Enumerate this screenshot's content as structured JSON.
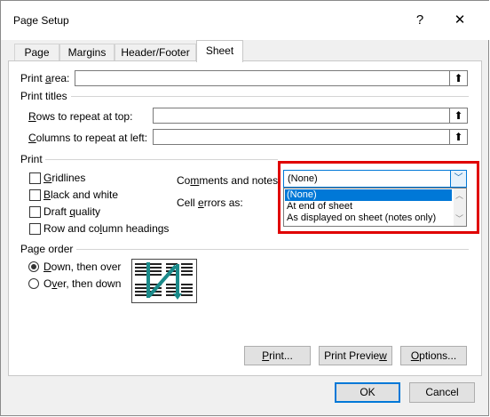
{
  "window": {
    "title": "Page Setup",
    "help": "?",
    "close": "✕"
  },
  "tabs": [
    {
      "label": "Page"
    },
    {
      "label": "Margins"
    },
    {
      "label": "Header/Footer"
    },
    {
      "label": "Sheet",
      "active": true
    }
  ],
  "print_area": {
    "label_pre": "Print ",
    "label_u": "a",
    "label_post": "rea:",
    "value": ""
  },
  "print_titles": {
    "heading": "Print titles",
    "rows_pre": "",
    "rows_u": "R",
    "rows_post": "ows to repeat at top:",
    "cols_pre": "",
    "cols_u": "C",
    "cols_post": "olumns to repeat at left:",
    "rows_value": "",
    "cols_value": ""
  },
  "print": {
    "heading": "Print",
    "gridlines": {
      "pre": "",
      "u": "G",
      "post": "ridlines",
      "checked": false
    },
    "bw": {
      "pre": "",
      "u": "B",
      "post": "lack and white",
      "checked": false
    },
    "draft": {
      "pre": "Draft ",
      "u": "q",
      "post": "uality",
      "checked": false
    },
    "headings": {
      "pre": "Row and co",
      "u": "l",
      "post": "umn headings",
      "checked": false
    },
    "comments_label_pre": "Co",
    "comments_label_u": "m",
    "comments_label_post": "ments and notes:",
    "comments_value": "(None)",
    "cell_errors_label_pre": "Cell ",
    "cell_errors_label_u": "e",
    "cell_errors_label_post": "rrors as:",
    "comment_options": [
      "(None)",
      "At end of sheet",
      "As displayed on sheet (notes only)"
    ]
  },
  "page_order": {
    "heading": "Page order",
    "down_pre": "",
    "down_u": "D",
    "down_post": "own, then over",
    "over_pre": "O",
    "over_u": "v",
    "over_post": "er, then down",
    "selected": "down"
  },
  "buttons": {
    "print_pre": "",
    "print_u": "P",
    "print_post": "rint...",
    "preview_pre": "Print Previe",
    "preview_u": "w",
    "preview_post": "",
    "options_pre": "",
    "options_u": "O",
    "options_post": "ptions...",
    "ok": "OK",
    "cancel": "Cancel"
  },
  "colors": {
    "accent": "#0078d7",
    "highlight": "#e00000",
    "arrow": "#1a8a8a"
  }
}
